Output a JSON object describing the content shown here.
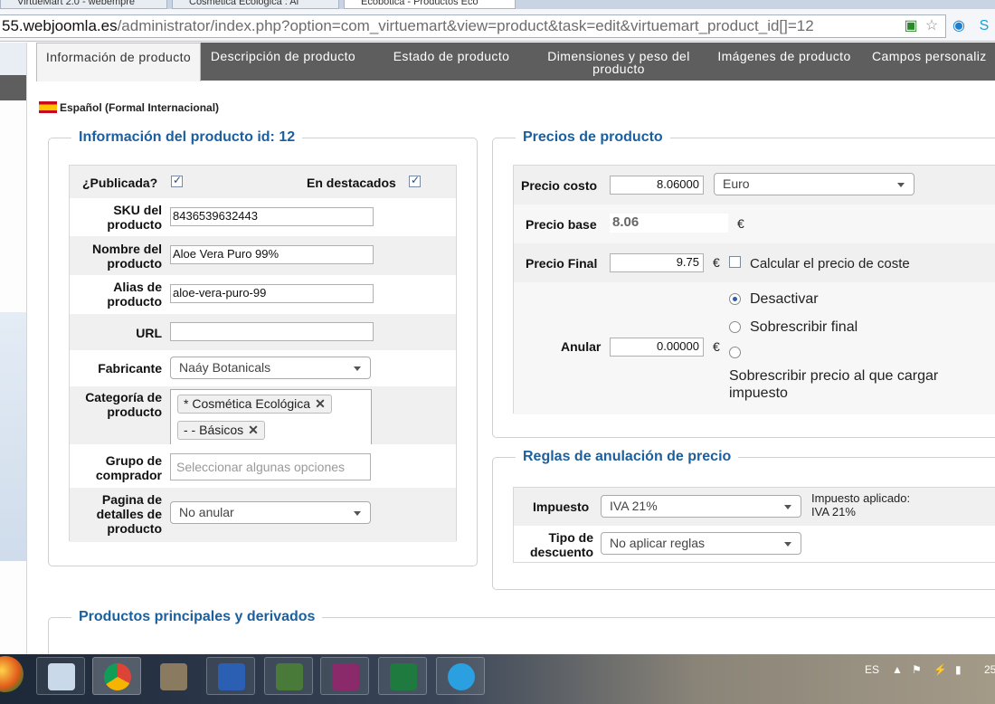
{
  "browser": {
    "tabs": [
      "VirtueMart 2.0 - webempre",
      "Cosmética Ecológica : Al",
      "Ecobotica - Productos Eco"
    ],
    "url_host": "55.webjoomla.es",
    "url_path": "/administrator/index.php?option=com_virtuemart&view=product&task=edit&virtuemart_product_id[]=12"
  },
  "tabs": [
    "Información de producto",
    "Descripción de producto",
    "Estado de producto",
    "Dimensiones y peso del producto",
    "Imágenes de producto",
    "Campos personaliz"
  ],
  "language": "Español (Formal Internacional)",
  "product_info": {
    "legend": "Información del producto id: 12",
    "published_label": "¿Publicada?",
    "published": true,
    "featured_label": "En destacados",
    "featured": true,
    "sku_label": "SKU del producto",
    "sku": "8436539632443",
    "name_label": "Nombre del producto",
    "name": "Aloe Vera Puro 99%",
    "alias_label": "Alias de producto",
    "alias": "aloe-vera-puro-99",
    "url_label": "URL",
    "url": "",
    "manufacturer_label": "Fabricante",
    "manufacturer": "Naáy Botanicals",
    "category_label": "Categoría de producto",
    "categories": [
      "* Cosmética Ecológica",
      "- - Básicos"
    ],
    "buyer_group_label": "Grupo de comprador",
    "buyer_group_placeholder": "Seleccionar algunas opciones",
    "details_page_label": "Pagina de detalles de producto",
    "details_page": "No anular"
  },
  "prices": {
    "legend": "Precios de producto",
    "cost_label": "Precio costo",
    "cost": "8.06000",
    "currency": "Euro",
    "base_label": "Precio base",
    "base": "8.06",
    "euro": "€",
    "final_label": "Precio Final",
    "final": "9.75",
    "calc_cost_label": "Calcular el precio de coste",
    "override_label": "Anular",
    "override": "0.00000",
    "option_disable": "Desactivar",
    "option_overwrite_final": "Sobrescribir final",
    "option_overwrite_tax": "Sobrescribir precio al que cargar impuesto"
  },
  "rules": {
    "legend": "Reglas de anulación de precio",
    "tax_label": "Impuesto",
    "tax": "IVA 21%",
    "tax_applied_label": "Impuesto aplicado:",
    "tax_applied": "IVA 21%",
    "discount_label": "Tipo de descuento",
    "discount": "No aplicar reglas"
  },
  "related": {
    "legend": "Productos principales y derivados"
  },
  "taskbar": {
    "lang": "ES",
    "clock": "25"
  }
}
